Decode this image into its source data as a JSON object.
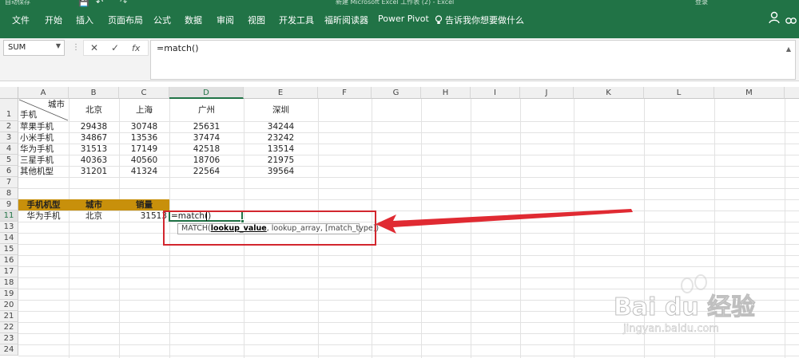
{
  "titlebar": {
    "doc_title": "新建 Microsoft Excel 工作表 (2) - Excel",
    "login": "登录",
    "qat_autosave": "自动保存"
  },
  "menu": [
    "文件",
    "开始",
    "插入",
    "页面布局",
    "公式",
    "数据",
    "审阅",
    "视图",
    "开发工具",
    "福昕阅读器",
    "Power Pivot"
  ],
  "tell_me": "告诉我你想要做什么",
  "formula_bar": {
    "namebox": "SUM",
    "cancel": "✕",
    "enter": "✓",
    "fx": "fx",
    "formula": "=match()"
  },
  "columns": [
    "A",
    "B",
    "C",
    "D",
    "E",
    "F",
    "G",
    "H",
    "I",
    "J",
    "K",
    "L",
    "M"
  ],
  "rows": [
    "1",
    "2",
    "3",
    "4",
    "5",
    "6",
    "7",
    "8",
    "9",
    "11",
    "13",
    "14",
    "15",
    "16",
    "17",
    "18",
    "19",
    "20",
    "21",
    "22",
    "23",
    "24"
  ],
  "table": {
    "header_city": "城市",
    "header_phone": "手机",
    "cities": [
      "北京",
      "上海",
      "广州",
      "深圳"
    ],
    "data": [
      {
        "name": "苹果手机",
        "values": [
          "29438",
          "30748",
          "25631",
          "34244"
        ]
      },
      {
        "name": "小米手机",
        "values": [
          "34867",
          "13536",
          "37474",
          "23242"
        ]
      },
      {
        "name": "华为手机",
        "values": [
          "31513",
          "17149",
          "42518",
          "13514"
        ]
      },
      {
        "name": "三星手机",
        "values": [
          "40363",
          "40560",
          "18706",
          "21975"
        ]
      },
      {
        "name": "其他机型",
        "values": [
          "31201",
          "41324",
          "22564",
          "39564"
        ]
      }
    ]
  },
  "lookup": {
    "headers": [
      "手机机型",
      "城市",
      "销量"
    ],
    "row": [
      "华为手机",
      "北京",
      "31513"
    ],
    "editing": "=match()"
  },
  "tooltip": {
    "func": "MATCH(",
    "arg1": "lookup_value",
    "rest": ", lookup_array, [match_type])"
  },
  "watermark": {
    "brand": "Bai du 经验",
    "url": "jingyan.baidu.com"
  },
  "colors": {
    "ribbon": "#217346",
    "header_band": "#c8900b",
    "annotation": "#d2262e"
  }
}
